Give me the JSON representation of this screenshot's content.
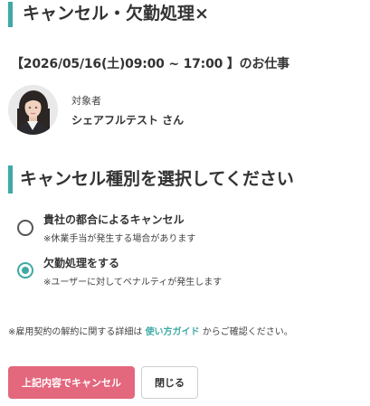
{
  "dialog": {
    "title": "キャンセル・欠勤処理",
    "close_glyph": "×"
  },
  "job": {
    "heading": "【2026/05/16(土)09:00 ~ 17:00 】のお仕事"
  },
  "person": {
    "label": "対象者",
    "name": "シェアフルテスト さん"
  },
  "cancel_type": {
    "heading": "キャンセル種別を選択してください",
    "selected": "absence",
    "options": [
      {
        "id": "company",
        "label": "貴社の都合によるキャンセル",
        "note": "※休業手当が発生する場合があります",
        "checked": false
      },
      {
        "id": "absence",
        "label": "欠勤処理をする",
        "note": "※ユーザーに対してペナルティが発生します",
        "checked": true
      }
    ]
  },
  "footnote": {
    "prefix": "※雇用契約の解約に関する詳細は ",
    "link": "使い方ガイド",
    "suffix": " からご確認ください。"
  },
  "buttons": {
    "submit_label": "上記内容でキャンセル",
    "close_label": "閉じる"
  },
  "colors": {
    "accent": "#3fa9a5",
    "primary_button": "#e3677d"
  }
}
